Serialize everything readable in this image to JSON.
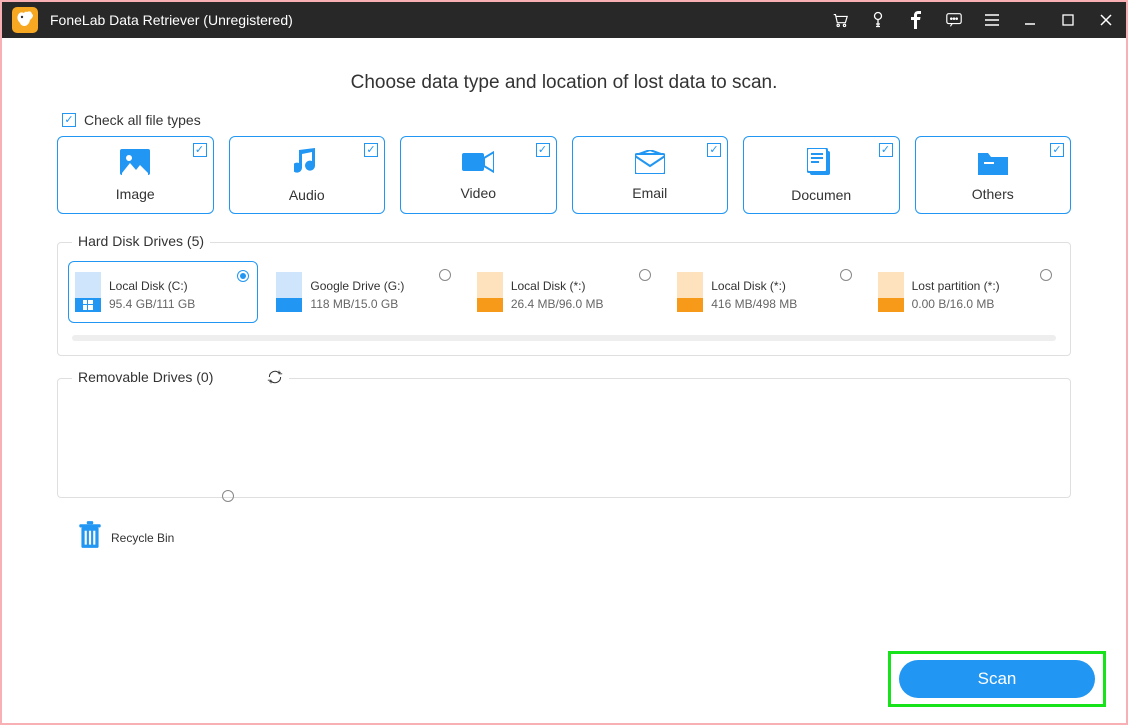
{
  "app": {
    "title": "FoneLab Data Retriever (Unregistered)"
  },
  "headline": "Choose data type and location of lost data to scan.",
  "check_all_label": "Check all file types",
  "types": [
    {
      "label": "Image"
    },
    {
      "label": "Audio"
    },
    {
      "label": "Video"
    },
    {
      "label": "Email"
    },
    {
      "label": "Documen"
    },
    {
      "label": "Others"
    }
  ],
  "sections": {
    "hdd": {
      "legend": "Hard Disk Drives (5)"
    },
    "removable": {
      "legend": "Removable Drives (0)"
    }
  },
  "drives": [
    {
      "name": "Local Disk (C:)",
      "size": "95.4 GB/111 GB",
      "selected": true,
      "color": "blue",
      "win": true
    },
    {
      "name": "Google Drive (G:)",
      "size": "118 MB/15.0 GB",
      "selected": false,
      "color": "blue",
      "win": false
    },
    {
      "name": "Local Disk (*:)",
      "size": "26.4 MB/96.0 MB",
      "selected": false,
      "color": "orange",
      "win": false
    },
    {
      "name": "Local Disk (*:)",
      "size": "416 MB/498 MB",
      "selected": false,
      "color": "orange",
      "win": false
    },
    {
      "name": "Lost partition (*:)",
      "size": "0.00  B/16.0 MB",
      "selected": false,
      "color": "orange",
      "win": false
    }
  ],
  "recycle": {
    "label": "Recycle Bin"
  },
  "scan_label": "Scan"
}
